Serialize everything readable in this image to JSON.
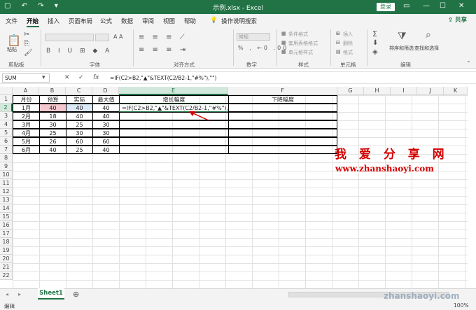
{
  "titlebar": {
    "title": "示例.xlsx  -  Excel",
    "login": "登录",
    "quick_access": "▢ ↶ ↷ ▾"
  },
  "tabs": [
    "文件",
    "开始",
    "插入",
    "页面布局",
    "公式",
    "数据",
    "审阅",
    "视图",
    "帮助",
    "操作说明搜索"
  ],
  "share_label": "共享",
  "ribbon": {
    "groups": [
      "剪贴板",
      "字体",
      "对齐方式",
      "数字",
      "样式",
      "单元格",
      "编辑"
    ],
    "paste_label": "粘贴",
    "number_format": "常规",
    "styles": [
      "条件格式",
      "套用表格格式",
      "单元格样式"
    ],
    "cells": [
      "插入",
      "删除",
      "格式"
    ],
    "editing": [
      "排序和筛选",
      "查找和选择"
    ]
  },
  "formula_bar": {
    "name_box": "SUM",
    "fx": "fx",
    "formula": "=IF(C2>B2,\"▲\"&TEXT(C2/B2-1,\"#%\"),\"\")"
  },
  "columns": [
    "A",
    "B",
    "C",
    "D",
    "E",
    "F",
    "G",
    "H",
    "I",
    "J",
    "K"
  ],
  "rows": [
    "1",
    "2",
    "3",
    "4",
    "5",
    "6",
    "7",
    "8",
    "9",
    "10",
    "11",
    "12",
    "13",
    "14",
    "15",
    "16",
    "17",
    "18",
    "19",
    "20",
    "21",
    "22"
  ],
  "table": {
    "headers": [
      "月份",
      "预算",
      "实际",
      "最大值",
      "增长幅度",
      "下降幅度"
    ],
    "rows": [
      [
        "1月",
        "40",
        "40",
        "40"
      ],
      [
        "2月",
        "18",
        "40",
        "40"
      ],
      [
        "3月",
        "30",
        "25",
        "30"
      ],
      [
        "4月",
        "25",
        "30",
        "30"
      ],
      [
        "5月",
        "26",
        "60",
        "60"
      ],
      [
        "6月",
        "40",
        "25",
        "40"
      ]
    ],
    "edit_cell": "=IF(C2>B2,\"▲\"&TEXT(C2/B2-1,\"#%\"),\"\")"
  },
  "watermark": {
    "cn": "我 爱 分 享 网",
    "url": "www.zhanshaoyi.com",
    "bottom": "zhanshaoyi.com"
  },
  "sheet": {
    "tab": "Sheet1",
    "add": "⊕"
  },
  "status": {
    "mode": "编辑",
    "zoom": "100%"
  },
  "colors": {
    "accent": "#217346",
    "pink": "#f4c7ce",
    "blue": "#dbe8f6",
    "watermark": "#d40000"
  }
}
